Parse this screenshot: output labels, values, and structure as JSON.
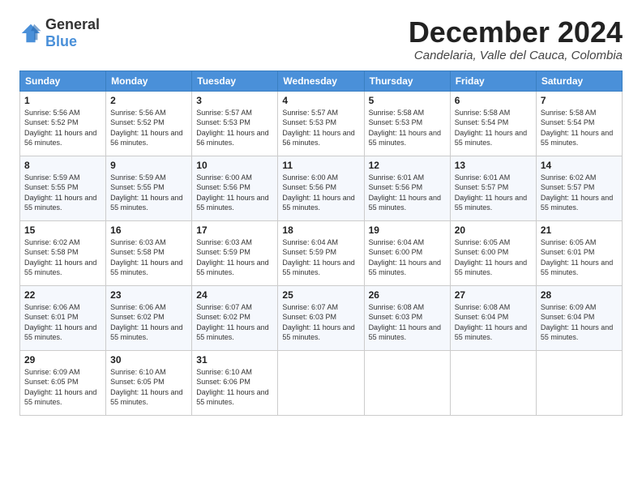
{
  "logo": {
    "general": "General",
    "blue": "Blue"
  },
  "title": "December 2024",
  "location": "Candelaria, Valle del Cauca, Colombia",
  "days_of_week": [
    "Sunday",
    "Monday",
    "Tuesday",
    "Wednesday",
    "Thursday",
    "Friday",
    "Saturday"
  ],
  "weeks": [
    [
      {
        "day": "1",
        "sunrise": "5:56 AM",
        "sunset": "5:52 PM",
        "daylight": "11 hours and 56 minutes."
      },
      {
        "day": "2",
        "sunrise": "5:56 AM",
        "sunset": "5:52 PM",
        "daylight": "11 hours and 56 minutes."
      },
      {
        "day": "3",
        "sunrise": "5:57 AM",
        "sunset": "5:53 PM",
        "daylight": "11 hours and 56 minutes."
      },
      {
        "day": "4",
        "sunrise": "5:57 AM",
        "sunset": "5:53 PM",
        "daylight": "11 hours and 56 minutes."
      },
      {
        "day": "5",
        "sunrise": "5:58 AM",
        "sunset": "5:53 PM",
        "daylight": "11 hours and 55 minutes."
      },
      {
        "day": "6",
        "sunrise": "5:58 AM",
        "sunset": "5:54 PM",
        "daylight": "11 hours and 55 minutes."
      },
      {
        "day": "7",
        "sunrise": "5:58 AM",
        "sunset": "5:54 PM",
        "daylight": "11 hours and 55 minutes."
      }
    ],
    [
      {
        "day": "8",
        "sunrise": "5:59 AM",
        "sunset": "5:55 PM",
        "daylight": "11 hours and 55 minutes."
      },
      {
        "day": "9",
        "sunrise": "5:59 AM",
        "sunset": "5:55 PM",
        "daylight": "11 hours and 55 minutes."
      },
      {
        "day": "10",
        "sunrise": "6:00 AM",
        "sunset": "5:56 PM",
        "daylight": "11 hours and 55 minutes."
      },
      {
        "day": "11",
        "sunrise": "6:00 AM",
        "sunset": "5:56 PM",
        "daylight": "11 hours and 55 minutes."
      },
      {
        "day": "12",
        "sunrise": "6:01 AM",
        "sunset": "5:56 PM",
        "daylight": "11 hours and 55 minutes."
      },
      {
        "day": "13",
        "sunrise": "6:01 AM",
        "sunset": "5:57 PM",
        "daylight": "11 hours and 55 minutes."
      },
      {
        "day": "14",
        "sunrise": "6:02 AM",
        "sunset": "5:57 PM",
        "daylight": "11 hours and 55 minutes."
      }
    ],
    [
      {
        "day": "15",
        "sunrise": "6:02 AM",
        "sunset": "5:58 PM",
        "daylight": "11 hours and 55 minutes."
      },
      {
        "day": "16",
        "sunrise": "6:03 AM",
        "sunset": "5:58 PM",
        "daylight": "11 hours and 55 minutes."
      },
      {
        "day": "17",
        "sunrise": "6:03 AM",
        "sunset": "5:59 PM",
        "daylight": "11 hours and 55 minutes."
      },
      {
        "day": "18",
        "sunrise": "6:04 AM",
        "sunset": "5:59 PM",
        "daylight": "11 hours and 55 minutes."
      },
      {
        "day": "19",
        "sunrise": "6:04 AM",
        "sunset": "6:00 PM",
        "daylight": "11 hours and 55 minutes."
      },
      {
        "day": "20",
        "sunrise": "6:05 AM",
        "sunset": "6:00 PM",
        "daylight": "11 hours and 55 minutes."
      },
      {
        "day": "21",
        "sunrise": "6:05 AM",
        "sunset": "6:01 PM",
        "daylight": "11 hours and 55 minutes."
      }
    ],
    [
      {
        "day": "22",
        "sunrise": "6:06 AM",
        "sunset": "6:01 PM",
        "daylight": "11 hours and 55 minutes."
      },
      {
        "day": "23",
        "sunrise": "6:06 AM",
        "sunset": "6:02 PM",
        "daylight": "11 hours and 55 minutes."
      },
      {
        "day": "24",
        "sunrise": "6:07 AM",
        "sunset": "6:02 PM",
        "daylight": "11 hours and 55 minutes."
      },
      {
        "day": "25",
        "sunrise": "6:07 AM",
        "sunset": "6:03 PM",
        "daylight": "11 hours and 55 minutes."
      },
      {
        "day": "26",
        "sunrise": "6:08 AM",
        "sunset": "6:03 PM",
        "daylight": "11 hours and 55 minutes."
      },
      {
        "day": "27",
        "sunrise": "6:08 AM",
        "sunset": "6:04 PM",
        "daylight": "11 hours and 55 minutes."
      },
      {
        "day": "28",
        "sunrise": "6:09 AM",
        "sunset": "6:04 PM",
        "daylight": "11 hours and 55 minutes."
      }
    ],
    [
      {
        "day": "29",
        "sunrise": "6:09 AM",
        "sunset": "6:05 PM",
        "daylight": "11 hours and 55 minutes."
      },
      {
        "day": "30",
        "sunrise": "6:10 AM",
        "sunset": "6:05 PM",
        "daylight": "11 hours and 55 minutes."
      },
      {
        "day": "31",
        "sunrise": "6:10 AM",
        "sunset": "6:06 PM",
        "daylight": "11 hours and 55 minutes."
      },
      null,
      null,
      null,
      null
    ]
  ]
}
